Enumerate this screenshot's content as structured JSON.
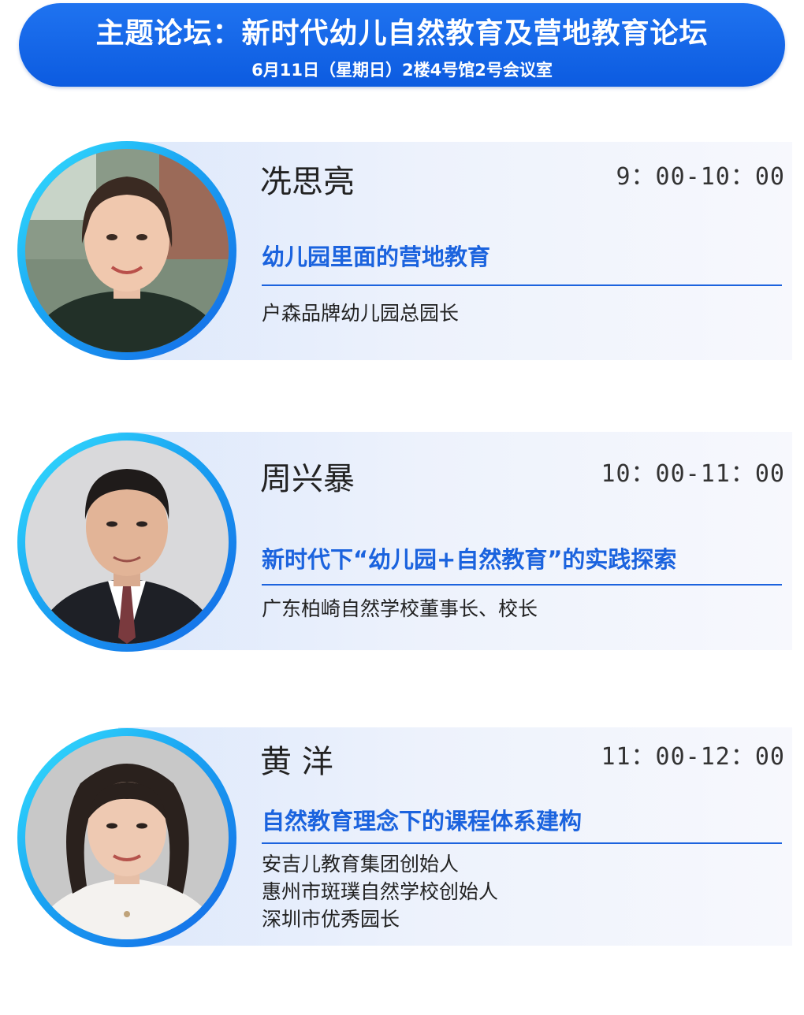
{
  "header": {
    "title": "主题论坛：新时代幼儿自然教育及营地教育论坛",
    "subtitle": "6月11日（星期日）2楼4号馆2号会议室"
  },
  "colors": {
    "header_blue": "#1466e6",
    "topic_blue": "#1b63de",
    "ring_cyan": "#36e3ff"
  },
  "speakers": [
    {
      "name": "冼思亮",
      "time": "9：00-10：00",
      "topic": "幼儿园里面的营地教育",
      "roles": [
        "户森品牌幼儿园总园长"
      ]
    },
    {
      "name": "周兴暴",
      "time": "10：00-11：00",
      "topic": "新时代下“幼儿园+自然教育”的实践探索",
      "roles": [
        "广东柏崎自然学校董事长、校长"
      ]
    },
    {
      "name": "黄 洋",
      "time": "11：00-12：00",
      "topic": "自然教育理念下的课程体系建构",
      "roles": [
        "安吉儿教育集团创始人",
        "惠州市斑璞自然学校创始人",
        "深圳市优秀园长"
      ]
    }
  ]
}
